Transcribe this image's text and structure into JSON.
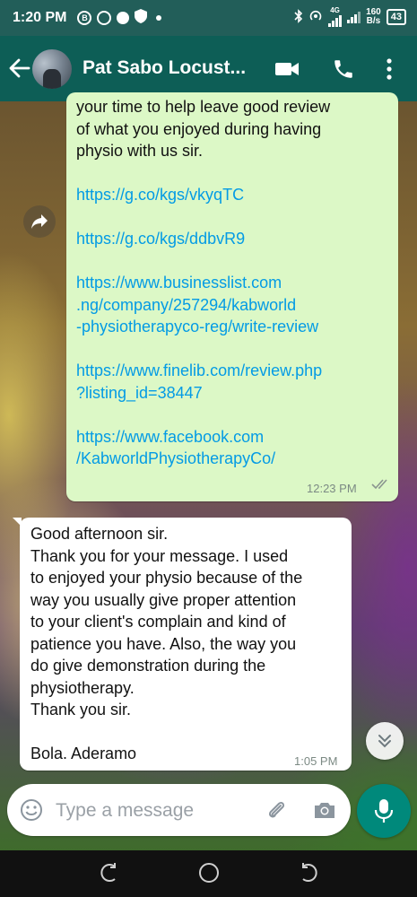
{
  "status_bar": {
    "time": "1:20 PM",
    "network_type": "4G",
    "speed_value": "160",
    "speed_unit": "B/s",
    "battery": "43"
  },
  "header": {
    "title": "Pat Sabo Locust..."
  },
  "messages": {
    "outgoing": {
      "lines": [
        {
          "text": "your time to help leave good review",
          "type": "text"
        },
        {
          "text": "of what you enjoyed during having",
          "type": "text"
        },
        {
          "text": "physio with us sir.",
          "type": "text"
        },
        {
          "text": "",
          "type": "blank"
        },
        {
          "text": "https://g.co/kgs/vkyqTC",
          "type": "link"
        },
        {
          "text": "",
          "type": "blank"
        },
        {
          "text": "https://g.co/kgs/ddbvR9",
          "type": "link"
        },
        {
          "text": "",
          "type": "blank"
        },
        {
          "text": "https://www.businesslist.com",
          "type": "link"
        },
        {
          "text": ".ng/company/257294/kabworld",
          "type": "link"
        },
        {
          "text": "-physiotherapyco-reg/write-review",
          "type": "link"
        },
        {
          "text": "",
          "type": "blank"
        },
        {
          "text": "https://www.finelib.com/review.php",
          "type": "link"
        },
        {
          "text": "?listing_id=38447",
          "type": "link"
        },
        {
          "text": "",
          "type": "blank"
        },
        {
          "text": "https://www.facebook.com",
          "type": "link"
        },
        {
          "text": "/KabworldPhysiotherapyCo/",
          "type": "link"
        }
      ],
      "time": "12:23 PM"
    },
    "incoming": {
      "lines": [
        "Good afternoon sir.",
        "Thank you for your message. I used",
        "to enjoyed your physio because of the",
        "way you usually give proper attention",
        "to your client's complain and kind of",
        "patience you have. Also, the way you",
        "do give demonstration during the",
        "physiotherapy.",
        "Thank you sir.",
        "",
        "Bola. Aderamo"
      ],
      "time": "1:05 PM"
    }
  },
  "composer": {
    "placeholder": "Type a message"
  },
  "colors": {
    "header": "#0d5e56",
    "outgoing_bubble": "#dcf8c6",
    "incoming_bubble": "#ffffff",
    "link": "#039be5",
    "mic_button": "#00897b"
  },
  "icons": {
    "back": "arrow-left-icon",
    "video": "video-camera-icon",
    "call": "phone-icon",
    "menu": "more-vertical-icon",
    "forward": "forward-icon",
    "scroll": "double-chevron-down-icon",
    "emoji": "emoji-icon",
    "attach": "paperclip-icon",
    "camera": "camera-icon",
    "mic": "microphone-icon"
  }
}
